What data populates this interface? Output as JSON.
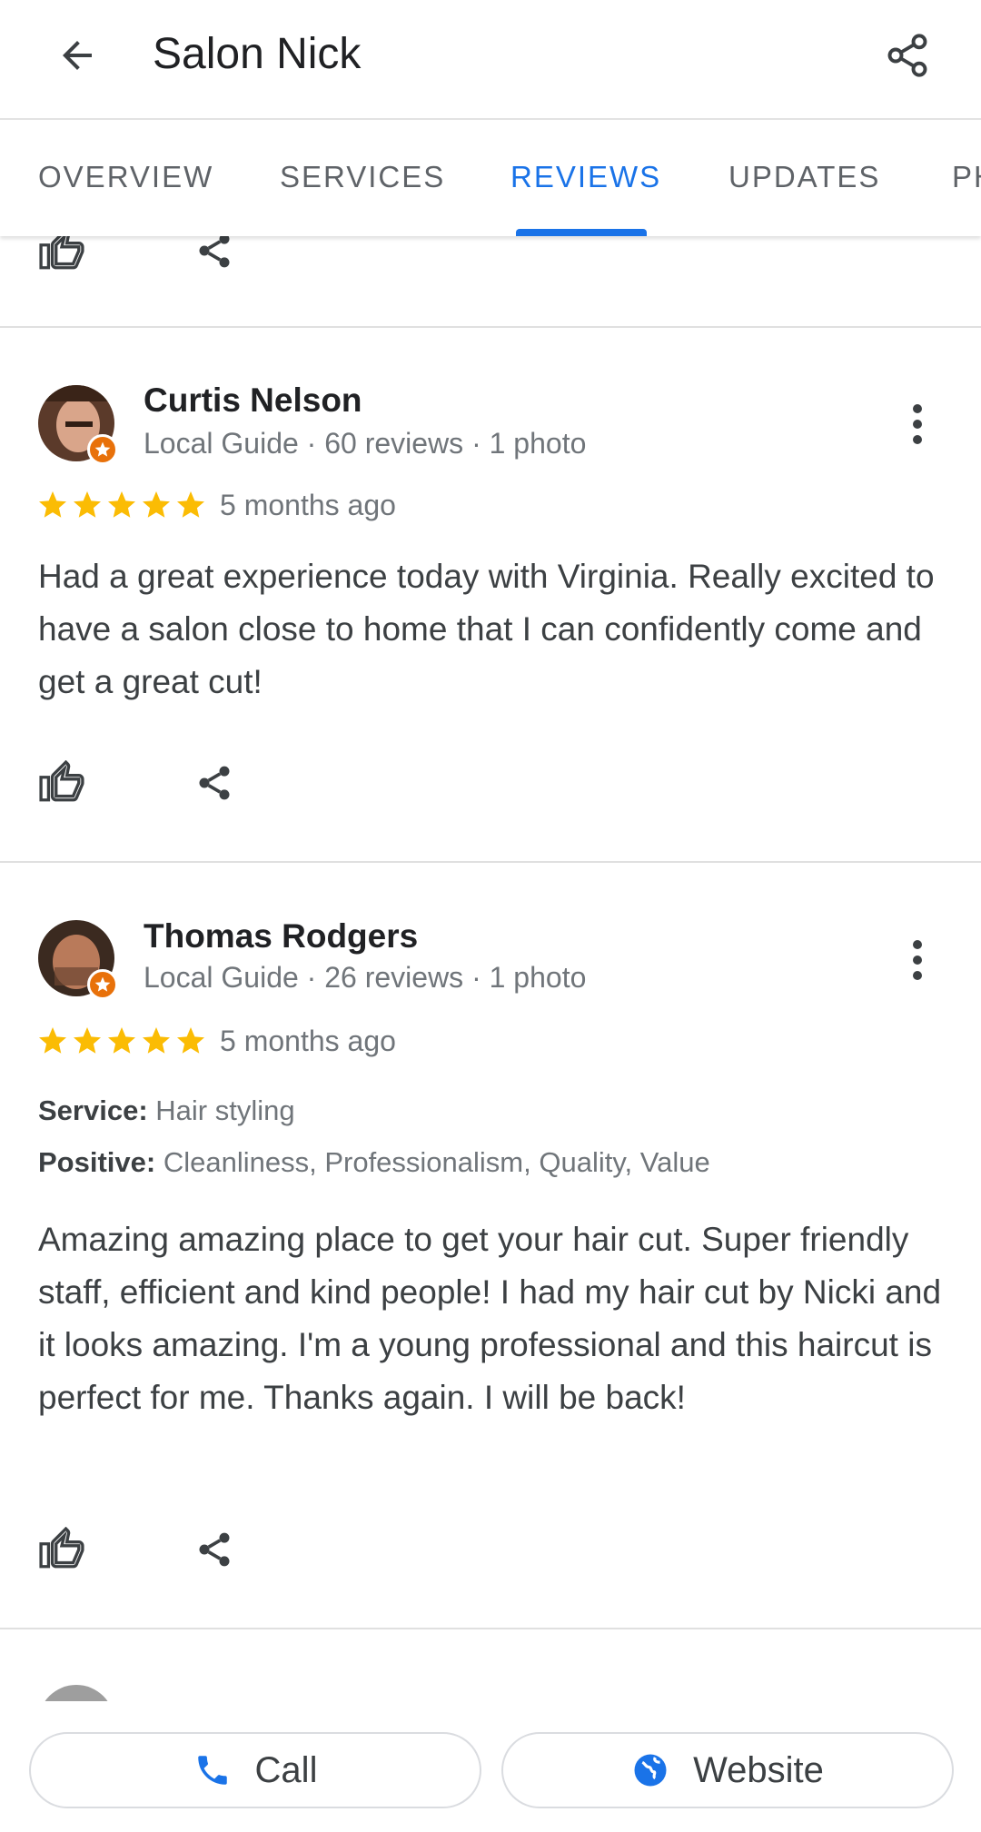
{
  "header": {
    "title": "Salon Nick"
  },
  "tabs": [
    {
      "label": "OVERVIEW"
    },
    {
      "label": "SERVICES"
    },
    {
      "label": "REVIEWS"
    },
    {
      "label": "UPDATES"
    },
    {
      "label": "PH"
    }
  ],
  "active_tab": "REVIEWS",
  "reviews": [
    {
      "name": "Curtis Nelson",
      "meta": "Local Guide · 60 reviews · 1 photo",
      "rating": 5,
      "time": "5 months ago",
      "text": "Had a great experience today with Virginia. Really excited to have a salon close to home that I can confidently come and get a great cut!"
    },
    {
      "name": "Thomas Rodgers",
      "meta": "Local Guide · 26 reviews · 1 photo",
      "rating": 5,
      "time": "5 months ago",
      "service_label": "Service:",
      "service_value": "Hair styling",
      "positive_label": "Positive:",
      "positive_value": "Cleanliness, Professionalism, Quality, Value",
      "text": "Amazing amazing place to get your hair cut. Super friendly staff, efficient and kind people! I had my hair cut by Nicki and it looks amazing. I'm a young professional and this haircut is perfect for me. Thanks again. I will be back!"
    }
  ],
  "bottom_bar": {
    "call_label": "Call",
    "website_label": "Website"
  },
  "colors": {
    "accent": "#1a73e8",
    "star": "#fbbc04",
    "guide_badge": "#e8710a"
  },
  "icons": [
    "back-arrow-icon",
    "share-icon",
    "thumbs-up-icon",
    "more-vert-icon",
    "star-icon",
    "phone-icon",
    "globe-icon",
    "local-guide-icon"
  ]
}
